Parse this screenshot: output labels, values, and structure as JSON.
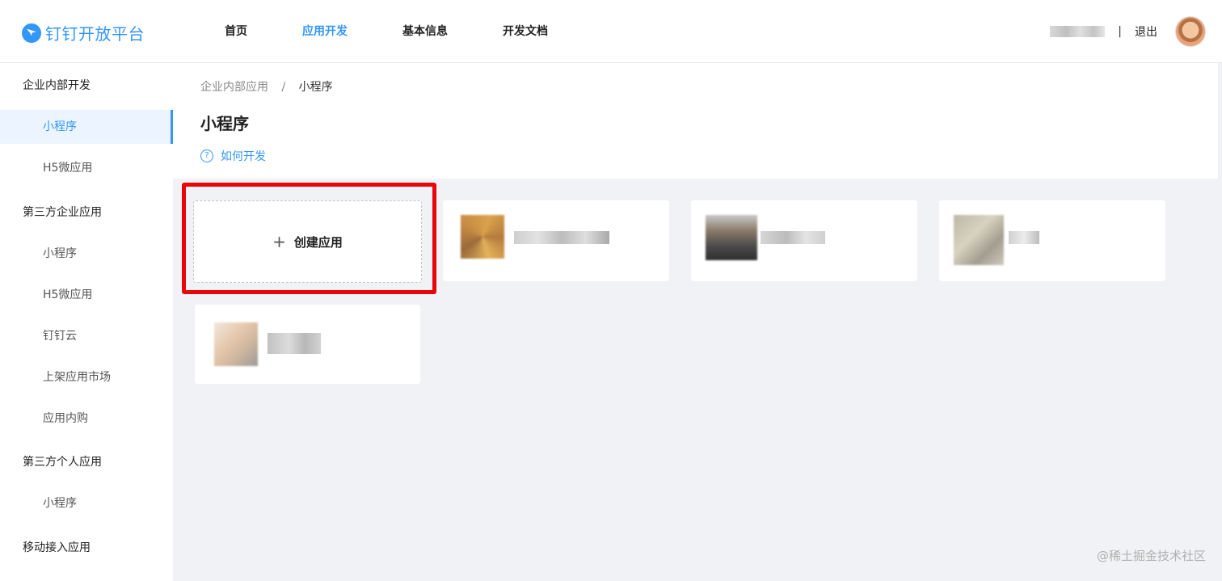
{
  "brand": {
    "name": "钉钉开放平台",
    "color": "#3296fa"
  },
  "nav": {
    "items": [
      {
        "label": "首页",
        "active": false
      },
      {
        "label": "应用开发",
        "active": true
      },
      {
        "label": "基本信息",
        "active": false
      },
      {
        "label": "开发文档",
        "active": false
      }
    ]
  },
  "user": {
    "separator": "|",
    "logout_label": "退出"
  },
  "sidebar": {
    "groups": [
      {
        "label": "企业内部开发",
        "items": [
          "小程序",
          "H5微应用"
        ]
      },
      {
        "label": "第三方企业应用",
        "items": [
          "小程序",
          "H5微应用",
          "钉钉云",
          "上架应用市场",
          "应用内购"
        ]
      },
      {
        "label": "第三方个人应用",
        "items": [
          "小程序"
        ]
      },
      {
        "label": "移动接入应用",
        "items": []
      }
    ],
    "active_item": "企业内部开发/小程序"
  },
  "breadcrumb": {
    "parent": "企业内部应用",
    "separator": "/",
    "current": "小程序"
  },
  "page": {
    "title": "小程序",
    "help_icon": "question-circle-icon",
    "help_label": "如何开发"
  },
  "create_card": {
    "icon": "plus-icon",
    "label": "创建应用"
  },
  "watermark": "@稀土掘金技术社区",
  "colors": {
    "accent": "#3296fa",
    "highlight": "#e8060a",
    "background": "#f0f2f5"
  }
}
